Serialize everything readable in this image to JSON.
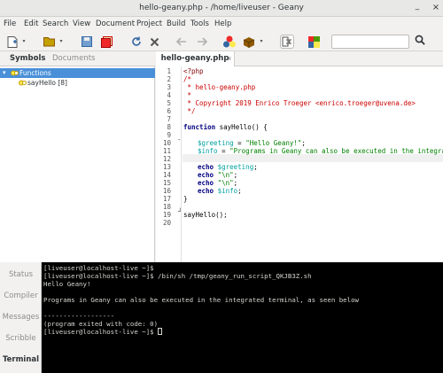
{
  "window": {
    "title": "hello-geany.php - /home/liveuser - Geany",
    "minimize": "_",
    "close": "×"
  },
  "menu": [
    "File",
    "Edit",
    "Search",
    "View",
    "Document",
    "Project",
    "Build",
    "Tools",
    "Help"
  ],
  "toolbar_icons": [
    "new-file-icon",
    "open-file-icon",
    "save-icon",
    "save-all-icon",
    "reload-icon",
    "close-file-icon",
    "back-icon",
    "forward-icon",
    "compile-icon",
    "build-icon",
    "execute-icon",
    "color-chooser-icon",
    "search-icon"
  ],
  "search": {
    "placeholder": ""
  },
  "sidebar": {
    "tabs": [
      "Symbols",
      "Documents"
    ],
    "items": [
      {
        "label": "Functions",
        "expand": "▾"
      },
      {
        "label": "sayHello [8]"
      }
    ]
  },
  "editor": {
    "tab": "hello-geany.php",
    "tab_close": "x",
    "line_numbers": [
      "1",
      "2",
      "3",
      "4",
      "5",
      "6",
      "7",
      "8",
      "9",
      "10",
      "11",
      "12",
      "13",
      "14",
      "15",
      "16",
      "17",
      "18",
      "19",
      "20"
    ],
    "fold_markers": {
      "function_start": "-",
      "function_end": "┘"
    },
    "code": {
      "l1": "<?php",
      "l2": "/*",
      "l3": " * hello-geany.php",
      "l4": " *",
      "l5": " * Copyright 2019 Enrico Troeger <enrico.troeger@uvena.de>",
      "l6": " */",
      "l8_kw": "function",
      "l8_rest": " sayHello() {",
      "l9": "",
      "l10_var": "$greeting",
      "l10_eq": " = ",
      "l10_str": "\"Hello Geany!\"",
      "l10_end": ";",
      "l11_var": "$info",
      "l11_eq": " = ",
      "l11_str": "\"Programs in Geany can also be executed in the integrated",
      "l13_kw": "echo",
      "l13_var": " $greeting",
      "l13_end": ";",
      "l14_kw": "echo",
      "l14_str": " \"\\n\"",
      "l14_end": ";",
      "l15_kw": "echo",
      "l15_str": " \"\\n\"",
      "l15_end": ";",
      "l16_kw": "echo",
      "l16_var": " $info",
      "l16_end": ";",
      "l17": "}",
      "l19": "sayHello();"
    }
  },
  "bottom_tabs": [
    "Status",
    "Compiler",
    "Messages",
    "Scribble",
    "Terminal"
  ],
  "terminal": {
    "lines": [
      "[liveuser@localhost-live ~]$",
      "[liveuser@localhost-live ~]$ /bin/sh /tmp/geany_run_script_QKJB3Z.sh",
      "Hello Geany!",
      "",
      "Programs in Geany can also be executed in the integrated terminal, as seen below",
      "",
      "------------------",
      "(program exited with code: 0)",
      "[liveuser@localhost-live ~]$"
    ]
  }
}
